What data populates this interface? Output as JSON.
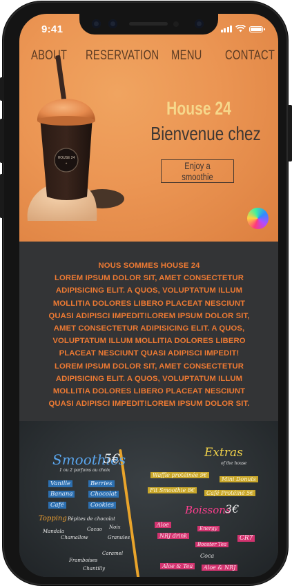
{
  "status_bar": {
    "time": "9:41"
  },
  "nav": {
    "items": [
      "ABOUT",
      "RESERVATION",
      "MENU",
      "CONTACT"
    ]
  },
  "hero": {
    "title": "House 24",
    "subtitle": "Bienvenue chez",
    "cta": "Enjoy a smoothie",
    "cup_label": "HOUSE 24"
  },
  "about": {
    "heading": "NOUS SOMMES HOUSE 24",
    "body": "LOREM IPSUM DOLOR SIT, AMET CONSECTETUR ADIPISICING ELIT. A QUOS, VOLUPTATUM ILLUM MOLLITIA DOLORES LIBERO PLACEAT NESCIUNT QUASI ADIPISCI IMPEDIT!LOREM IPSUM DOLOR SIT, AMET CONSECTETUR ADIPISICING ELIT. A QUOS, VOLUPTATUM ILLUM MOLLITIA DOLORES LIBERO PLACEAT NESCIUNT QUASI ADIPISCI IMPEDIT! LOREM IPSUM DOLOR SIT, AMET CONSECTETUR ADIPISICING ELIT. A QUOS, VOLUPTATUM ILLUM MOLLITIA DOLORES LIBERO PLACEAT NESCIUNT QUASI ADIPISCI IMPEDIT!LOREM IPSUM DOLOR SIT."
  },
  "menu_board": {
    "smoothies": {
      "title": "Smoothies",
      "price": "5€",
      "note": "1 ou 2 parfums au choix",
      "flavors": [
        "Vanille",
        "Berries",
        "Banana",
        "Chocolat",
        "Café",
        "Cookies"
      ]
    },
    "topping": {
      "label": "Topping :",
      "items": [
        "Pépites de chocolat",
        "Noix",
        "Cacao",
        "Mandala",
        "Chamallow",
        "Granules",
        "Caramel",
        "Chantilly",
        "Framboises"
      ]
    },
    "extras": {
      "title": "Extras",
      "subtitle": "of the house",
      "items": [
        "Waffle protéinée 9€",
        "Mini Donuts",
        "Fit Smoothie 8€",
        "Café Protéiné 5€"
      ]
    },
    "boissons": {
      "title": "Boissons",
      "price": "3€",
      "items": [
        "Aloe",
        "Energy",
        "NRJ drink",
        "Booster Tea",
        "Coca",
        "CR7",
        "Aloe & Tea",
        "Aloe & NRJ"
      ]
    }
  },
  "colors": {
    "hero_orange": "#eb9553",
    "about_text": "#ee7a33",
    "about_bg": "#333436",
    "title_yellow": "#f6d78b"
  }
}
